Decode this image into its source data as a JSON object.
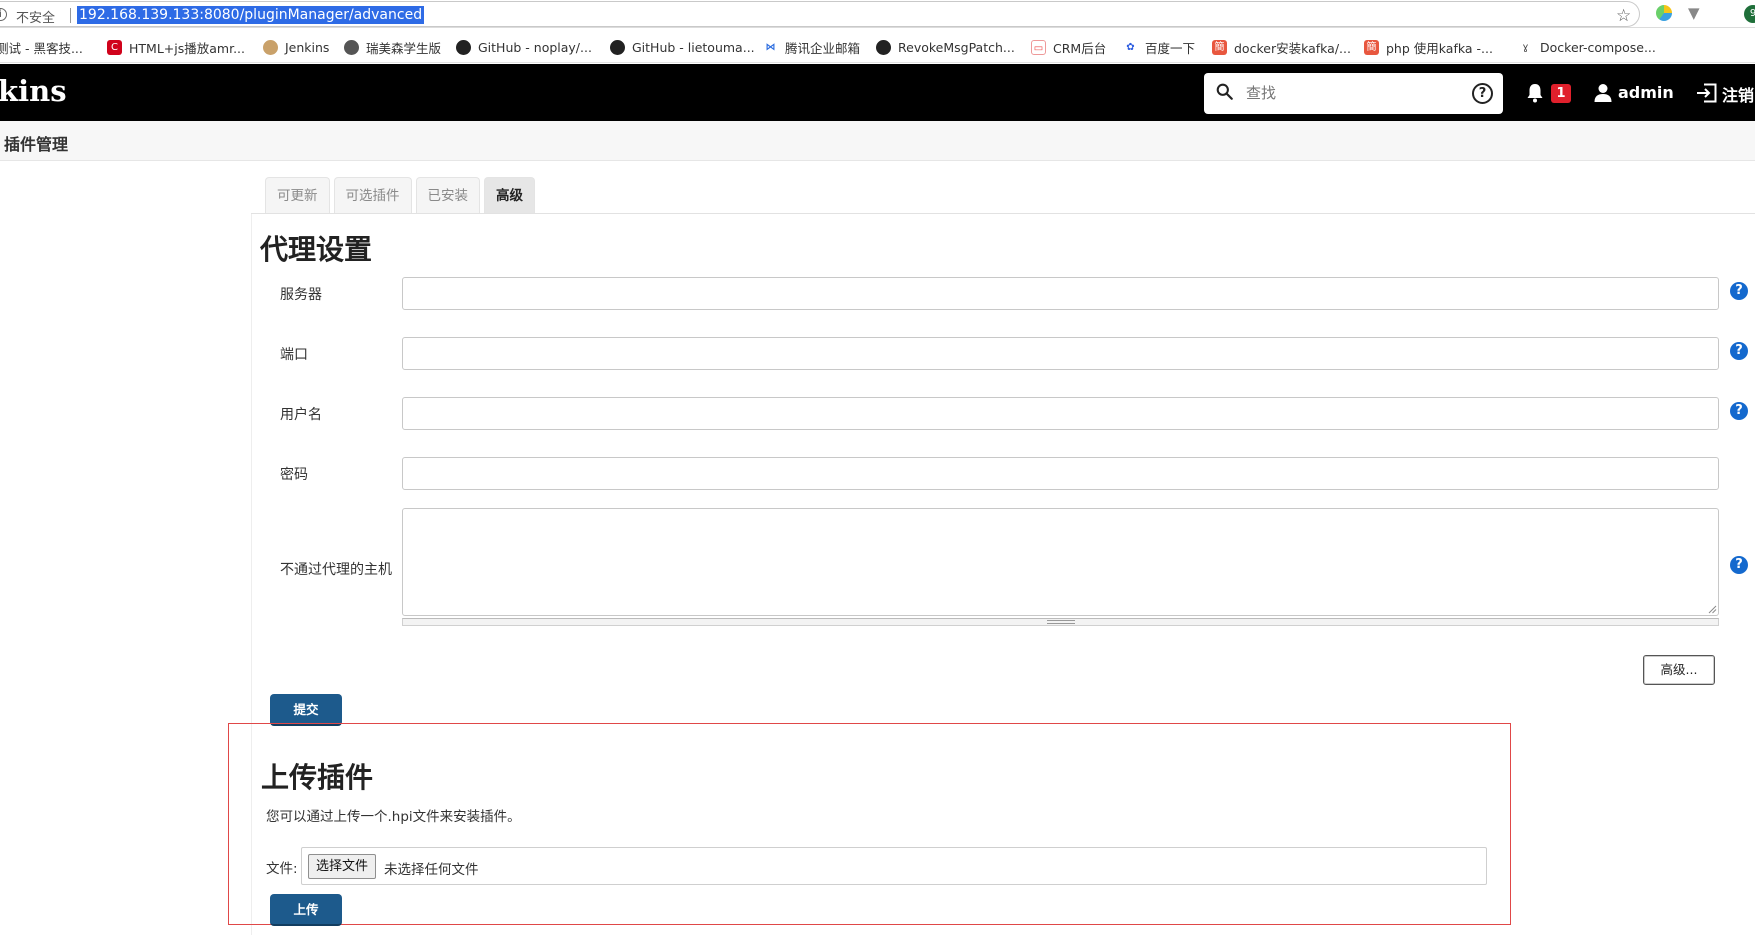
{
  "browser": {
    "insecure_label": "不安全",
    "url": "192.168.139.133:8080/pluginManager/advanced",
    "bookmarks": [
      {
        "label": "测试 - 黑客技..."
      },
      {
        "label": "HTML+js播放amr..."
      },
      {
        "label": "Jenkins"
      },
      {
        "label": "瑞美森学生版"
      },
      {
        "label": "GitHub - noplay/..."
      },
      {
        "label": "GitHub - lietouma..."
      },
      {
        "label": "腾讯企业邮箱"
      },
      {
        "label": "RevokeMsgPatch..."
      },
      {
        "label": "CRM后台"
      },
      {
        "label": "百度一下"
      },
      {
        "label": "docker安装kafka/..."
      },
      {
        "label": "php 使用kafka -..."
      },
      {
        "label": "Docker-compose..."
      }
    ],
    "ext_badge": "9"
  },
  "header": {
    "logo": "kins",
    "search_placeholder": "查找",
    "notification_count": "1",
    "user": "admin",
    "logout": "注销"
  },
  "breadcrumb": {
    "current": "插件管理"
  },
  "tabs": [
    {
      "label": "可更新",
      "active": false
    },
    {
      "label": "可选插件",
      "active": false
    },
    {
      "label": "已安装",
      "active": false
    },
    {
      "label": "高级",
      "active": true
    }
  ],
  "proxy": {
    "title": "代理设置",
    "fields": {
      "server": {
        "label": "服务器",
        "value": ""
      },
      "port": {
        "label": "端口",
        "value": ""
      },
      "username": {
        "label": "用户名",
        "value": ""
      },
      "password": {
        "label": "密码",
        "value": ""
      },
      "no_proxy_hosts": {
        "label": "不通过代理的主机",
        "value": ""
      }
    },
    "advanced_button": "高级...",
    "submit_button": "提交"
  },
  "upload": {
    "title": "上传插件",
    "description": "您可以通过上传一个.hpi文件来安装插件。",
    "file_label": "文件:",
    "choose_file": "选择文件",
    "no_file": "未选择任何文件",
    "upload_button": "上传"
  },
  "colors": {
    "header_bg": "#000000",
    "primary_button": "#1d5a8c",
    "help_icon": "#1469ce",
    "notification_badge": "#e0202c",
    "highlight_frame": "#e04848"
  }
}
